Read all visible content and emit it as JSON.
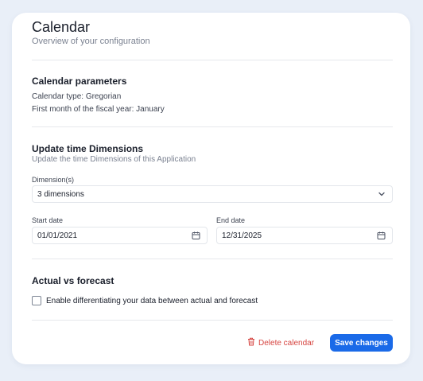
{
  "header": {
    "title": "Calendar",
    "subtitle": "Overview of your configuration"
  },
  "calendar_parameters": {
    "title": "Calendar parameters",
    "calendar_type": "Calendar type: Gregorian",
    "fiscal_month": "First month of the fiscal year: January"
  },
  "time_dimensions": {
    "title": "Update time Dimensions",
    "subtitle": "Update the time Dimensions of this Application",
    "dimension_label": "Dimension(s)",
    "dimension_value": "3 dimensions",
    "start_label": "Start date",
    "start_value": "01/01/2021",
    "end_label": "End date",
    "end_value": "12/31/2025"
  },
  "actual_vs_forecast": {
    "title": "Actual vs forecast",
    "checkbox_label": "Enable differentiating your data between actual and forecast",
    "checked": false
  },
  "footer": {
    "delete_label": "Delete calendar",
    "save_label": "Save changes"
  },
  "colors": {
    "accent": "#1a6ae8",
    "danger": "#d64541",
    "background": "#e9eff8"
  },
  "icons": {
    "dropdown": "chevron-down-icon",
    "date": "calendar-icon",
    "delete": "trash-icon"
  }
}
